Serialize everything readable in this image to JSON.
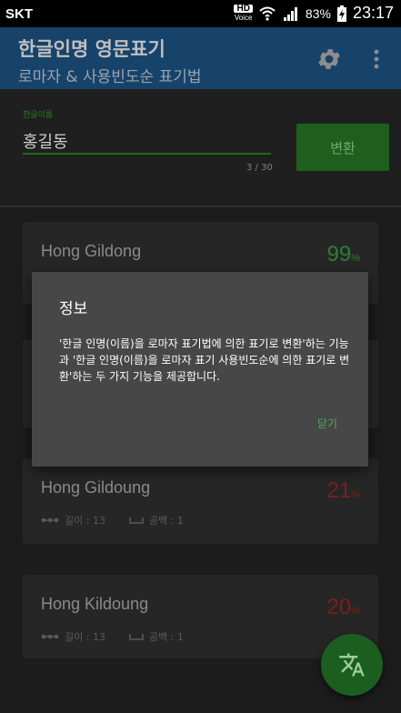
{
  "status_bar": {
    "carrier": "SKT",
    "hd_label": "HD",
    "voice_label": "Voice",
    "battery": "83%",
    "time": "23:17"
  },
  "app_bar": {
    "title": "한글인명 영문표기",
    "subtitle": "로마자 & 사용빈도순 표기법",
    "settings_icon": "gear-icon",
    "more_icon": "more-vert-icon"
  },
  "input": {
    "label": "한글이름",
    "value": "홍길동",
    "counter": "3 / 30",
    "convert_label": "변환"
  },
  "results": [
    {
      "name": "Hong Gildong",
      "score": "99",
      "unit": "%",
      "score_color": "#2e7d32",
      "length_label": "",
      "space_label": ""
    },
    {
      "name": "Hong Gildoung",
      "score": "21",
      "unit": "%",
      "score_color": "#7b1f1f",
      "length_label": "길이 : 13",
      "space_label": "공백 : 1"
    },
    {
      "name": "Hong Kildoung",
      "score": "20",
      "unit": "%",
      "score_color": "#7b1f1f",
      "length_label": "길이 : 13",
      "space_label": "공백 : 1"
    }
  ],
  "dialog": {
    "title": "정보",
    "message": "'한글 인명(이름)을 로마자 표기법에 의한 표기로 변환'하는 기능과 '한글 인명(이름)을 로마자 표기 사용빈도순에 의한 표기로 변환'하는 두 가지 기능을 제공합니다.",
    "close_label": "닫기"
  },
  "fab": {
    "icon": "translate-icon"
  },
  "colors": {
    "app_bar": "#17436b",
    "accent": "#4caf50",
    "button": "#1e5f1e"
  }
}
